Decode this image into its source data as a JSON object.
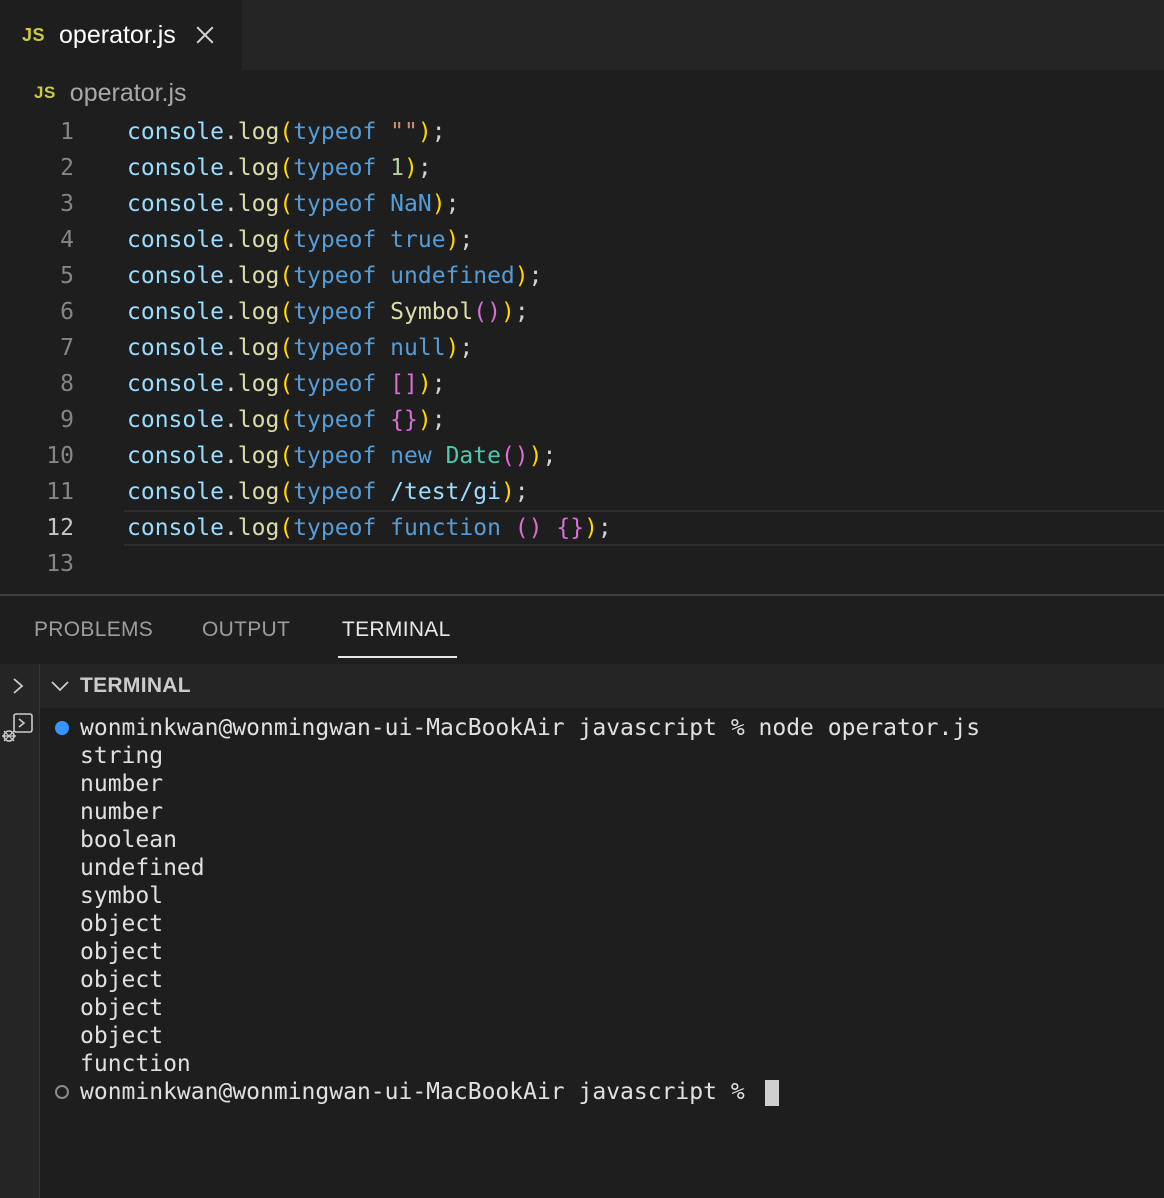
{
  "tab": {
    "badge": "JS",
    "label": "operator.js"
  },
  "breadcrumb": {
    "badge": "JS",
    "label": "operator.js"
  },
  "editor": {
    "line_numbers": [
      "1",
      "2",
      "3",
      "4",
      "5",
      "6",
      "7",
      "8",
      "9",
      "10",
      "11",
      "12",
      "13"
    ],
    "active_line": "12",
    "lines": [
      [
        [
          "console",
          "obj"
        ],
        [
          ".",
          "punc"
        ],
        [
          "log",
          "fn"
        ],
        [
          "(",
          "p1"
        ],
        [
          "typeof",
          "kw"
        ],
        [
          " ",
          "punc"
        ],
        [
          "\"\"",
          "str"
        ],
        [
          ")",
          "p1"
        ],
        [
          ";",
          "punc"
        ]
      ],
      [
        [
          "console",
          "obj"
        ],
        [
          ".",
          "punc"
        ],
        [
          "log",
          "fn"
        ],
        [
          "(",
          "p1"
        ],
        [
          "typeof",
          "kw"
        ],
        [
          " ",
          "punc"
        ],
        [
          "1",
          "num"
        ],
        [
          ")",
          "p1"
        ],
        [
          ";",
          "punc"
        ]
      ],
      [
        [
          "console",
          "obj"
        ],
        [
          ".",
          "punc"
        ],
        [
          "log",
          "fn"
        ],
        [
          "(",
          "p1"
        ],
        [
          "typeof",
          "kw"
        ],
        [
          " ",
          "punc"
        ],
        [
          "NaN",
          "kw"
        ],
        [
          ")",
          "p1"
        ],
        [
          ";",
          "punc"
        ]
      ],
      [
        [
          "console",
          "obj"
        ],
        [
          ".",
          "punc"
        ],
        [
          "log",
          "fn"
        ],
        [
          "(",
          "p1"
        ],
        [
          "typeof",
          "kw"
        ],
        [
          " ",
          "punc"
        ],
        [
          "true",
          "kw"
        ],
        [
          ")",
          "p1"
        ],
        [
          ";",
          "punc"
        ]
      ],
      [
        [
          "console",
          "obj"
        ],
        [
          ".",
          "punc"
        ],
        [
          "log",
          "fn"
        ],
        [
          "(",
          "p1"
        ],
        [
          "typeof",
          "kw"
        ],
        [
          " ",
          "punc"
        ],
        [
          "undefined",
          "kw"
        ],
        [
          ")",
          "p1"
        ],
        [
          ";",
          "punc"
        ]
      ],
      [
        [
          "console",
          "obj"
        ],
        [
          ".",
          "punc"
        ],
        [
          "log",
          "fn"
        ],
        [
          "(",
          "p1"
        ],
        [
          "typeof",
          "kw"
        ],
        [
          " ",
          "punc"
        ],
        [
          "Symbol",
          "fn"
        ],
        [
          "()",
          "p2"
        ],
        [
          ")",
          "p1"
        ],
        [
          ";",
          "punc"
        ]
      ],
      [
        [
          "console",
          "obj"
        ],
        [
          ".",
          "punc"
        ],
        [
          "log",
          "fn"
        ],
        [
          "(",
          "p1"
        ],
        [
          "typeof",
          "kw"
        ],
        [
          " ",
          "punc"
        ],
        [
          "null",
          "kw"
        ],
        [
          ")",
          "p1"
        ],
        [
          ";",
          "punc"
        ]
      ],
      [
        [
          "console",
          "obj"
        ],
        [
          ".",
          "punc"
        ],
        [
          "log",
          "fn"
        ],
        [
          "(",
          "p1"
        ],
        [
          "typeof",
          "kw"
        ],
        [
          " ",
          "punc"
        ],
        [
          "[]",
          "p2"
        ],
        [
          ")",
          "p1"
        ],
        [
          ";",
          "punc"
        ]
      ],
      [
        [
          "console",
          "obj"
        ],
        [
          ".",
          "punc"
        ],
        [
          "log",
          "fn"
        ],
        [
          "(",
          "p1"
        ],
        [
          "typeof",
          "kw"
        ],
        [
          " ",
          "punc"
        ],
        [
          "{}",
          "p2"
        ],
        [
          ")",
          "p1"
        ],
        [
          ";",
          "punc"
        ]
      ],
      [
        [
          "console",
          "obj"
        ],
        [
          ".",
          "punc"
        ],
        [
          "log",
          "fn"
        ],
        [
          "(",
          "p1"
        ],
        [
          "typeof",
          "kw"
        ],
        [
          " ",
          "punc"
        ],
        [
          "new",
          "kw"
        ],
        [
          " ",
          "punc"
        ],
        [
          "Date",
          "cls"
        ],
        [
          "()",
          "p2"
        ],
        [
          ")",
          "p1"
        ],
        [
          ";",
          "punc"
        ]
      ],
      [
        [
          "console",
          "obj"
        ],
        [
          ".",
          "punc"
        ],
        [
          "log",
          "fn"
        ],
        [
          "(",
          "p1"
        ],
        [
          "typeof",
          "kw"
        ],
        [
          " ",
          "punc"
        ],
        [
          "/test/gi",
          "obj"
        ],
        [
          ")",
          "p1"
        ],
        [
          ";",
          "punc"
        ]
      ],
      [
        [
          "console",
          "obj"
        ],
        [
          ".",
          "punc"
        ],
        [
          "log",
          "fn"
        ],
        [
          "(",
          "p1"
        ],
        [
          "typeof",
          "kw"
        ],
        [
          " ",
          "punc"
        ],
        [
          "function",
          "kw"
        ],
        [
          " ",
          "punc"
        ],
        [
          "()",
          "p2"
        ],
        [
          " ",
          "punc"
        ],
        [
          "{}",
          "p2"
        ],
        [
          ")",
          "p1"
        ],
        [
          ";",
          "punc"
        ]
      ],
      []
    ]
  },
  "panel": {
    "tabs": [
      "PROBLEMS",
      "OUTPUT",
      "TERMINAL"
    ],
    "active_tab": "TERMINAL",
    "terminal_title": "TERMINAL"
  },
  "terminal": {
    "prompt": "wonminkwan@wonmingwan-ui-MacBookAir javascript % ",
    "command": "node operator.js",
    "output": [
      "string",
      "number",
      "number",
      "boolean",
      "undefined",
      "symbol",
      "object",
      "object",
      "object",
      "object",
      "object",
      "function"
    ],
    "final_prompt": "wonminkwan@wonmingwan-ui-MacBookAir javascript % "
  },
  "colors": {
    "accent_dot": "#3794ff",
    "js_badge": "#cbcb41"
  },
  "icons": [
    "close-icon",
    "chevron-right-icon",
    "chevron-down-icon",
    "terminal-debug-icon"
  ]
}
